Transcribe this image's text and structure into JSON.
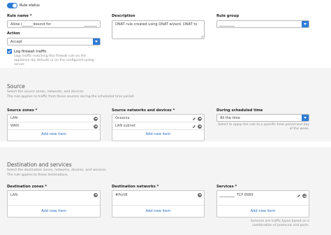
{
  "rule_status": {
    "label": "Rule status",
    "enabled": true
  },
  "rule_name": {
    "label": "Rule name *",
    "value": "Allow        8989 inbound for"
  },
  "description": {
    "label": "Description",
    "value": "DNAT rule created using DNAT wizard. DNAT to"
  },
  "rule_group": {
    "label": "Rule group",
    "value": ""
  },
  "action": {
    "label": "Action",
    "value": "Accept"
  },
  "log_traffic": {
    "label": "Log firewall traffic",
    "checked": true,
    "help": "Logs traffic matching this firewall rule on the appliance (by default) or on the configured syslog server."
  },
  "source": {
    "title": "Source",
    "desc1": "Select the source zones, networks, and devices.",
    "desc2": "The rule applies to traffic from these sources during the scheduled time period",
    "zones": {
      "label": "Source zones *",
      "items": [
        "LAN",
        "WAN"
      ],
      "add": "Add new item"
    },
    "networks": {
      "label": "Source networks and devices *",
      "items": [
        "Oceania",
        "LAN subnet"
      ],
      "add": "Add new item"
    },
    "schedule": {
      "label": "During scheduled time",
      "value": "All the time",
      "help": "Select to apply the rule to a specific time period and day of the week."
    }
  },
  "destination": {
    "title": "Destination and services",
    "desc1": "Select the destination zones, networks, devices, and services.",
    "desc2": "The rule applies to these destinations.",
    "zones": {
      "label": "Destination zones *",
      "items": [
        "LAN"
      ],
      "add": "Add new item"
    },
    "networks": {
      "label": "Destination networks *",
      "items": [
        "#PortB"
      ],
      "add": "Add new item"
    },
    "services": {
      "label": "Services *",
      "items": [
        "TCP 8989"
      ],
      "add": "Add new item",
      "help": "Services are traffic types based on a combination of protocols and ports."
    }
  },
  "colors": {
    "accent": "#2e7bd6",
    "toggle_on": "#2e7bd6",
    "link": "#2e6fc6"
  }
}
